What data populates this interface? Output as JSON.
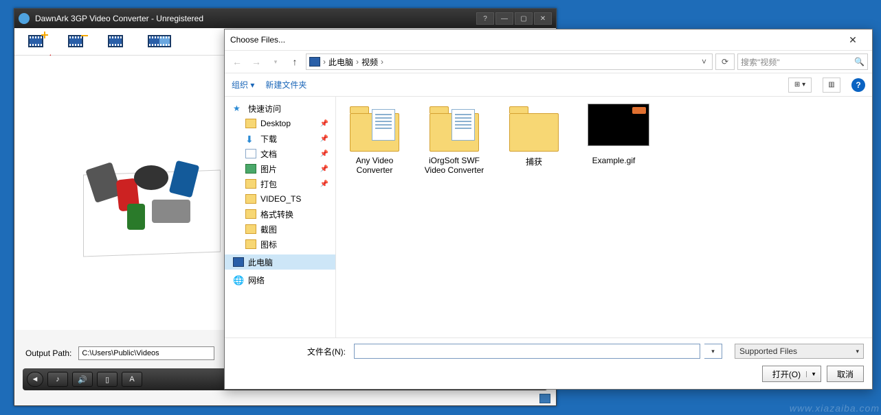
{
  "app": {
    "title": "DawnArk 3GP Video Converter - Unregistered",
    "output_label": "Output Path:",
    "output_value": "C:\\Users\\Public\\Videos"
  },
  "toolbar_btn": {
    "add": "add",
    "remove": "remove",
    "clear": "clear",
    "wide": "wide"
  },
  "profile_icons": {
    "back": "◄",
    "audio": "♪",
    "vol": "🔊",
    "mobile": "▯",
    "text": "A"
  },
  "dialog": {
    "title": "Choose Files...",
    "breadcrumb": {
      "a": "此电脑",
      "b": "视频"
    },
    "search_placeholder": "搜索\"视频\"",
    "cmd": {
      "organize": "组织 ▾",
      "newfolder": "新建文件夹"
    },
    "filename_label": "文件名(N):",
    "filter": "Supported Files",
    "open": "打开(O)",
    "cancel": "取消"
  },
  "tree": {
    "quick": "快速访问",
    "items": [
      {
        "label": "Desktop",
        "pin": true,
        "ico": "fold"
      },
      {
        "label": "下载",
        "pin": true,
        "ico": "dl"
      },
      {
        "label": "文档",
        "pin": true,
        "ico": "doc"
      },
      {
        "label": "图片",
        "pin": true,
        "ico": "pic"
      },
      {
        "label": "打包",
        "pin": true,
        "ico": "fold"
      },
      {
        "label": "VIDEO_TS",
        "pin": false,
        "ico": "fold"
      },
      {
        "label": "格式转换",
        "pin": false,
        "ico": "fold"
      },
      {
        "label": "截图",
        "pin": false,
        "ico": "fold"
      },
      {
        "label": "图标",
        "pin": false,
        "ico": "fold"
      }
    ],
    "pc": "此电脑",
    "net": "网络"
  },
  "files": [
    {
      "label": "Any Video Converter",
      "type": "folder-doc"
    },
    {
      "label": "iOrgSoft SWF Video Converter",
      "type": "folder-doc"
    },
    {
      "label": "捕获",
      "type": "folder"
    },
    {
      "label": "Example.gif",
      "type": "gif"
    }
  ],
  "watermark": "www.xiazaiba.com"
}
